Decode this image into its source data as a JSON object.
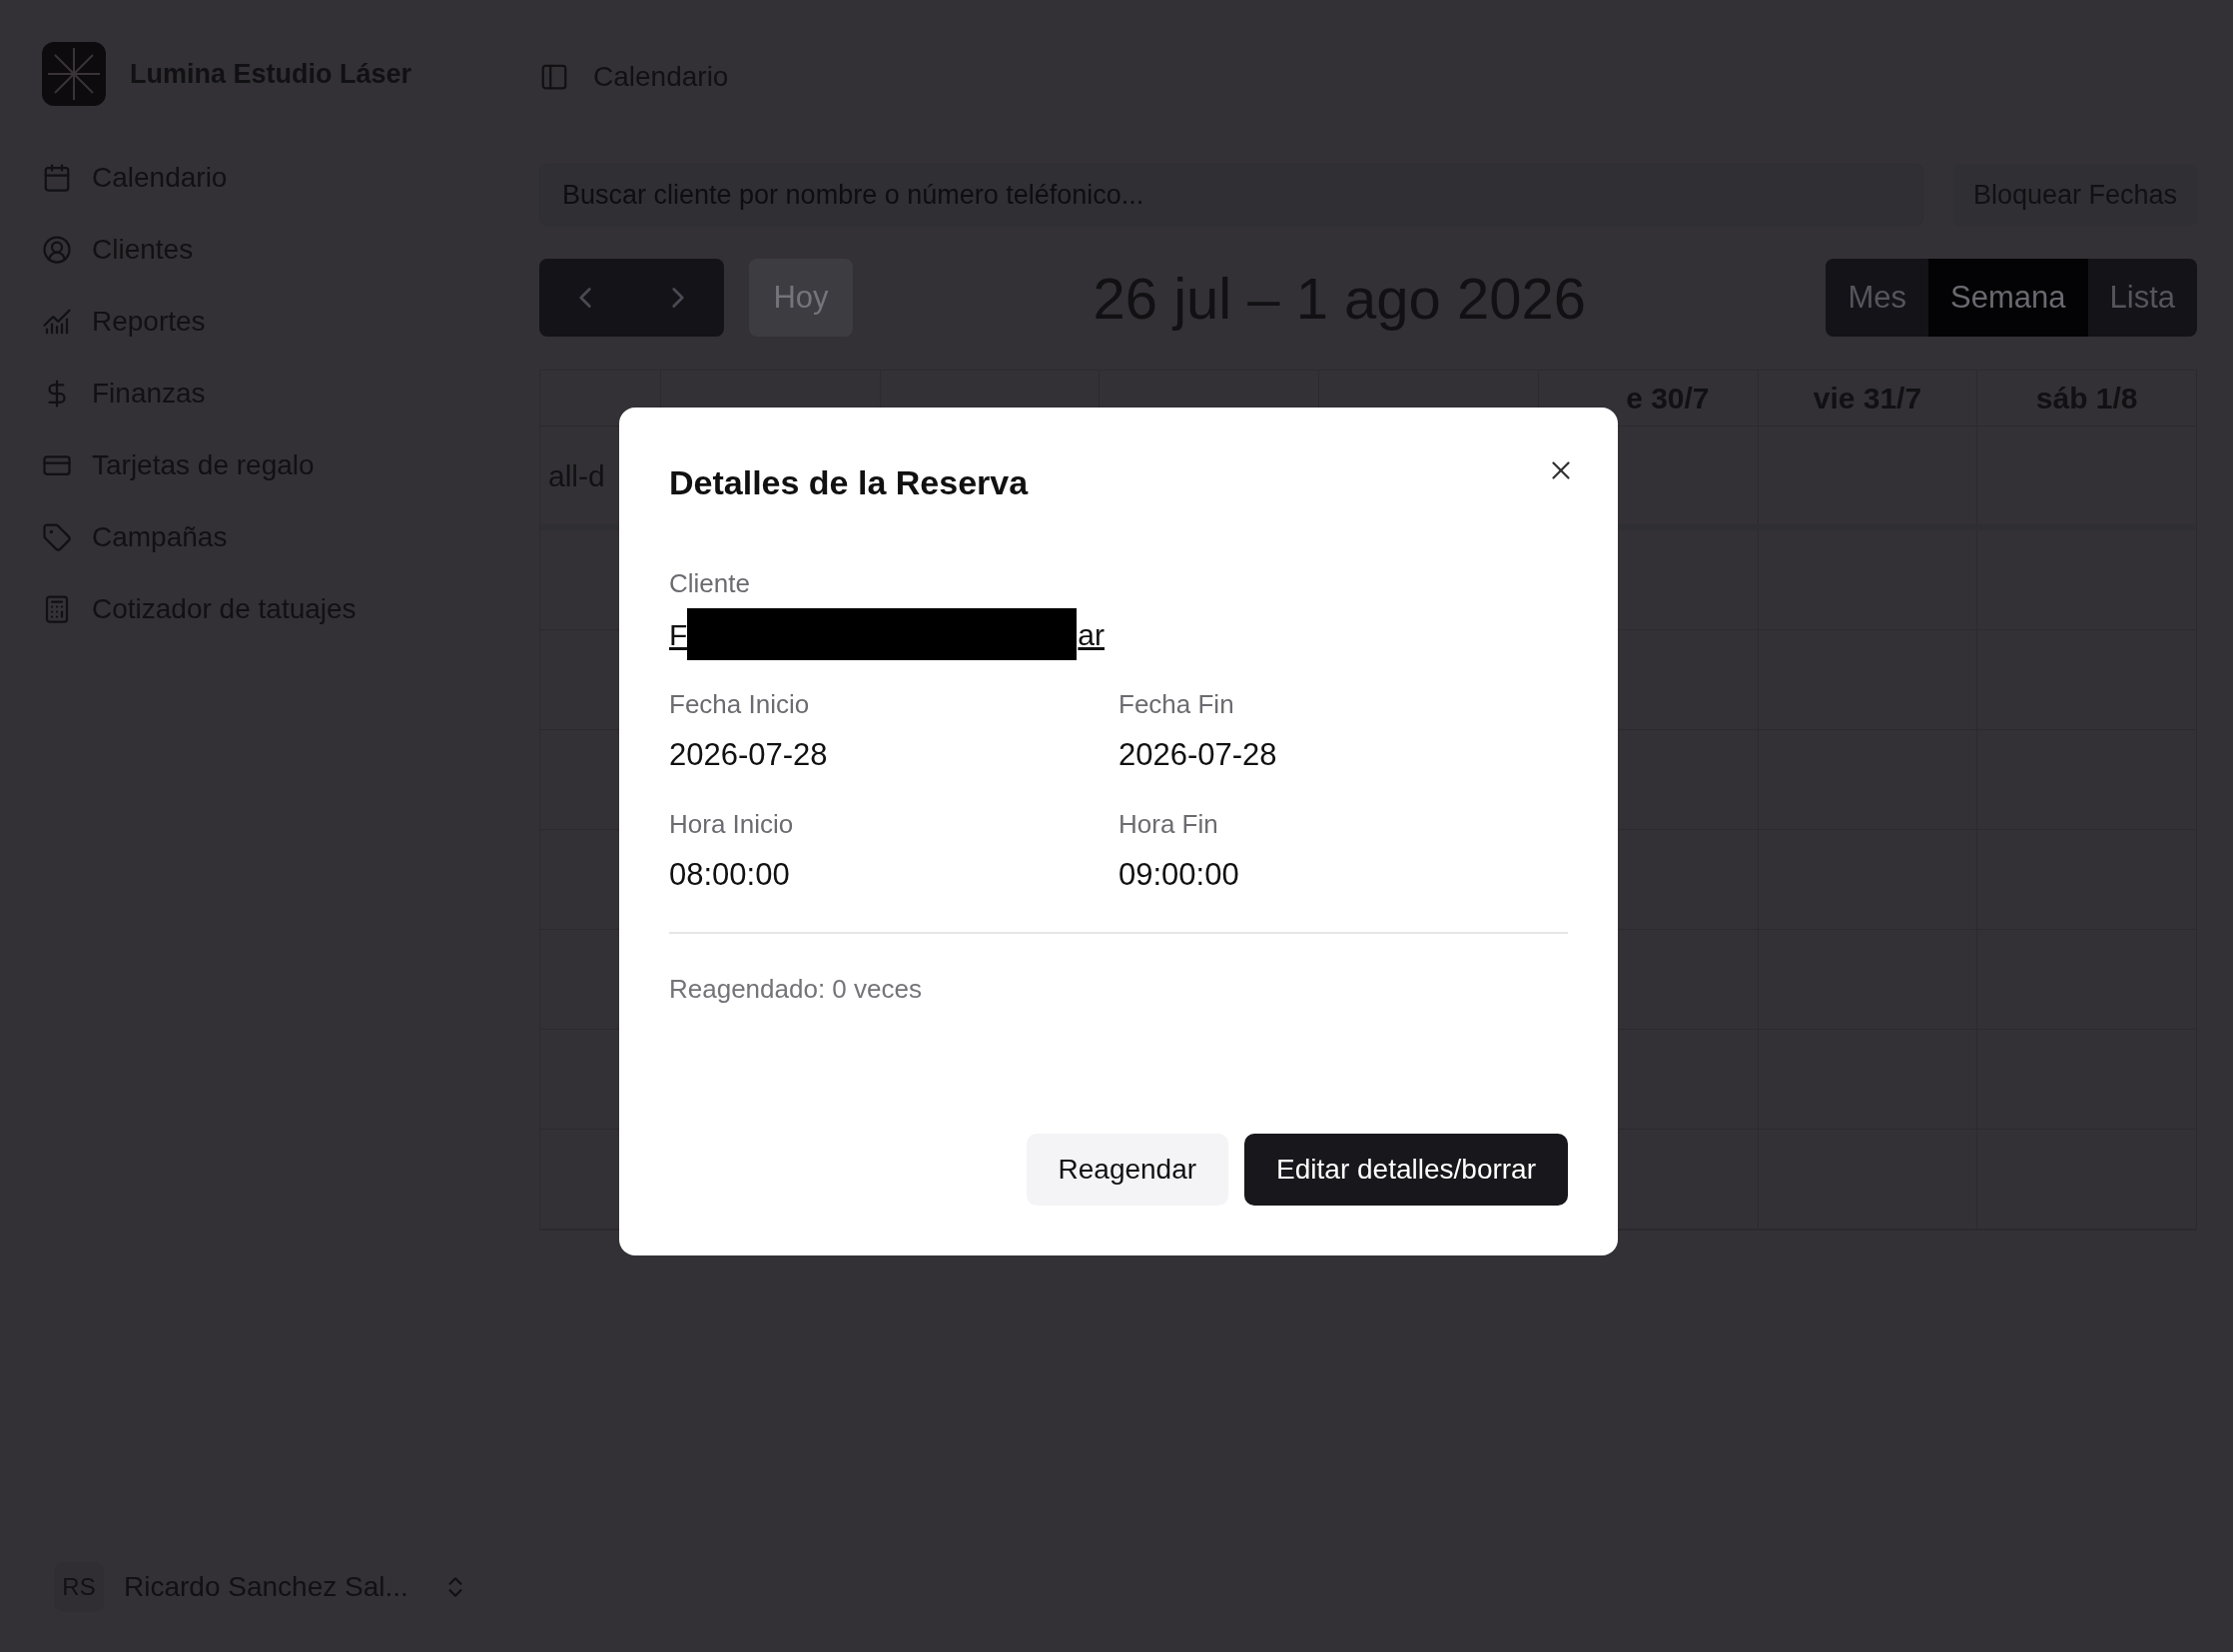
{
  "sidebar": {
    "brand": "Lumina Estudio Láser",
    "items": [
      {
        "label": "Calendario"
      },
      {
        "label": "Clientes"
      },
      {
        "label": "Reportes"
      },
      {
        "label": "Finanzas"
      },
      {
        "label": "Tarjetas de regalo"
      },
      {
        "label": "Campañas"
      },
      {
        "label": "Cotizador de tatuajes"
      }
    ],
    "user": {
      "initials": "RS",
      "name": "Ricardo Sanchez Sal..."
    }
  },
  "header": {
    "title": "Calendario"
  },
  "search": {
    "placeholder": "Buscar cliente por nombre o número teléfonico..."
  },
  "block_button": "Bloquear Fechas",
  "toolbar": {
    "today": "Hoy",
    "range_title": "26 jul – 1 ago 2026",
    "views": [
      {
        "label": "Mes",
        "selected": false
      },
      {
        "label": "Semana",
        "selected": true
      },
      {
        "label": "Lista",
        "selected": false
      }
    ]
  },
  "calendar": {
    "visible_day_headers": [
      "e 30/7",
      "vie 31/7",
      "sáb 1/8"
    ],
    "all_day_label": "all-d"
  },
  "dialog": {
    "title": "Detalles de la Reserva",
    "client": {
      "label": "Cliente",
      "visible_start": "F",
      "visible_end": "ar"
    },
    "fields": [
      {
        "label": "Fecha Inicio",
        "value": "2026-07-28"
      },
      {
        "label": "Fecha Fin",
        "value": "2026-07-28"
      },
      {
        "label": "Hora Inicio",
        "value": "08:00:00"
      },
      {
        "label": "Hora Fin",
        "value": "09:00:00"
      }
    ],
    "rescheduled": "Reagendado: 0 veces",
    "buttons": [
      {
        "label": "Reagendar",
        "kind": "secondary"
      },
      {
        "label": "Editar detalles/borrar",
        "kind": "primary"
      }
    ]
  }
}
